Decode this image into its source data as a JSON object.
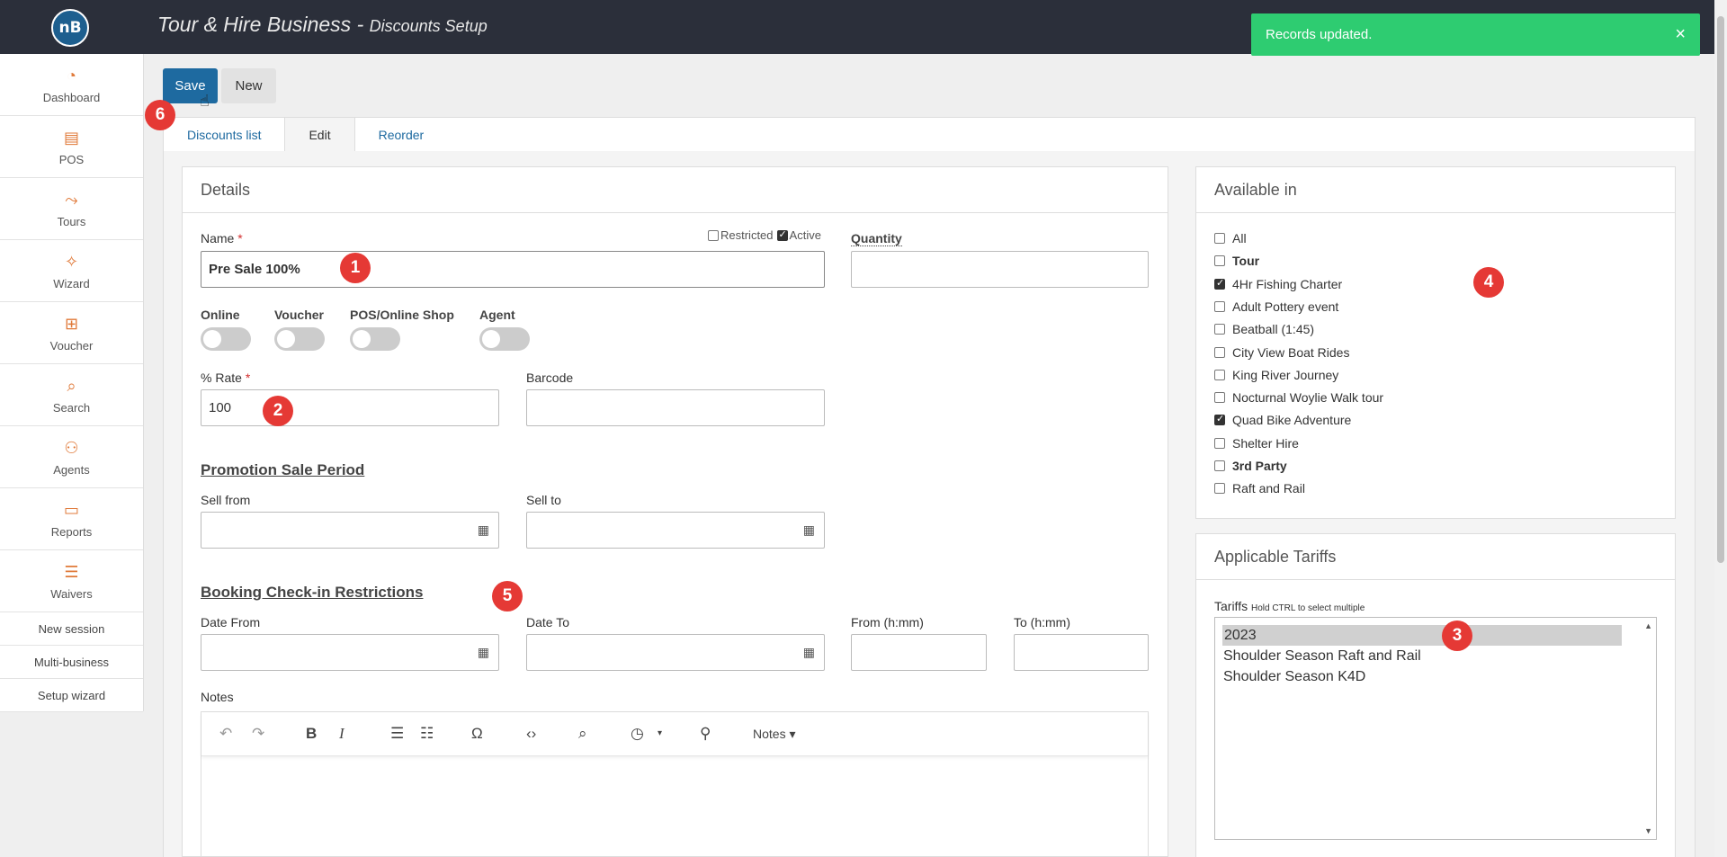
{
  "header": {
    "logo_text": "nB",
    "title": "Tour & Hire Business",
    "title_sep": " - ",
    "subtitle": "Discounts Setup"
  },
  "toast": {
    "message": "Records updated.",
    "close": "×"
  },
  "sidebar": {
    "items": [
      {
        "label": "Dashboard",
        "icon": "◔"
      },
      {
        "label": "POS",
        "icon": "▤"
      },
      {
        "label": "Tours",
        "icon": "⤳"
      },
      {
        "label": "Wizard",
        "icon": "✧"
      },
      {
        "label": "Voucher",
        "icon": "⊞"
      },
      {
        "label": "Search",
        "icon": "⌕"
      },
      {
        "label": "Agents",
        "icon": "⚇"
      },
      {
        "label": "Reports",
        "icon": "▭"
      },
      {
        "label": "Waivers",
        "icon": "☰"
      }
    ],
    "links": [
      "New session",
      "Multi-business",
      "Setup wizard"
    ]
  },
  "toolbar": {
    "save_label": "Save",
    "new_label": "New"
  },
  "tabs": [
    "Discounts list",
    "Edit",
    "Reorder"
  ],
  "details": {
    "heading": "Details",
    "name_label": "Name",
    "required_mark": "*",
    "name_value": "Pre Sale 100%",
    "restricted_label": "Restricted",
    "active_label": "Active",
    "quantity_label": "Quantity",
    "quantity_value": "",
    "toggles": [
      {
        "label": "Online",
        "on": false
      },
      {
        "label": "Voucher",
        "on": false
      },
      {
        "label": "POS/Online Shop",
        "on": false
      },
      {
        "label": "Agent",
        "on": false
      }
    ],
    "rate_label": "% Rate",
    "rate_value": "100",
    "barcode_label": "Barcode",
    "barcode_value": "",
    "promo_title": "Promotion Sale Period",
    "sell_from_label": "Sell from",
    "sell_to_label": "Sell to",
    "booking_title": "Booking Check-in Restrictions",
    "date_from_label": "Date From",
    "date_to_label": "Date To",
    "from_hmm_label": "From (h:mm)",
    "to_hmm_label": "To (h:mm)",
    "notes_label": "Notes",
    "editor_format_label": "Notes"
  },
  "available": {
    "heading": "Available in",
    "items": [
      {
        "label": "All",
        "checked": false,
        "bold": false
      },
      {
        "label": "Tour",
        "checked": false,
        "bold": true
      },
      {
        "label": "4Hr Fishing Charter",
        "checked": true,
        "bold": false
      },
      {
        "label": "Adult Pottery event",
        "checked": false,
        "bold": false
      },
      {
        "label": "Beatball (1:45)",
        "checked": false,
        "bold": false
      },
      {
        "label": "City View Boat Rides",
        "checked": false,
        "bold": false
      },
      {
        "label": "King River Journey",
        "checked": false,
        "bold": false
      },
      {
        "label": "Nocturnal Woylie Walk tour",
        "checked": false,
        "bold": false
      },
      {
        "label": "Quad Bike Adventure",
        "checked": true,
        "bold": false
      },
      {
        "label": "Shelter Hire",
        "checked": false,
        "bold": false
      },
      {
        "label": "3rd Party",
        "checked": false,
        "bold": true
      },
      {
        "label": "Raft and Rail",
        "checked": false,
        "bold": false
      }
    ]
  },
  "tariffs": {
    "heading": "Applicable Tariffs",
    "label": "Tariffs",
    "hint": "Hold CTRL to select multiple",
    "options": [
      "2023",
      "Shoulder Season Raft and Rail",
      "Shoulder Season K4D"
    ],
    "selected_index": 0
  },
  "annotations": [
    "1",
    "2",
    "3",
    "4",
    "5",
    "6"
  ]
}
